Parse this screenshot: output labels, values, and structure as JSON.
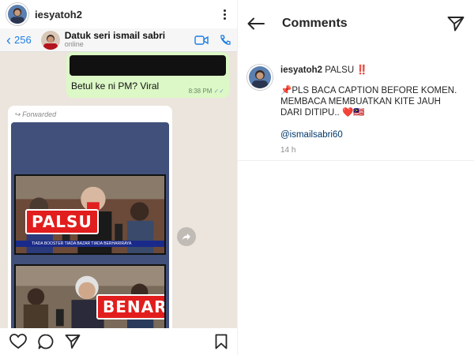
{
  "post": {
    "username": "iesyatoh2",
    "whatsapp": {
      "back_count": "256",
      "contact_name": "Datuk seri ismail sabri",
      "contact_status": "online",
      "outgoing_text": "Betul ke ni PM? Viral",
      "outgoing_time": "8:38 PM",
      "forwarded_label": "Forwarded",
      "stamp_fake": "PALSU",
      "stamp_real": "BENAR",
      "ticker_text": "TIADA BOOSTER TIADA BAZAR TIADA BERHARIRAYA"
    }
  },
  "comments": {
    "title": "Comments",
    "author": "iesyatoh2",
    "first_line": "PALSU ‼️",
    "body": "📌PLS BACA CAPTION BEFORE KOMEN. MEMBACA MEMBUATKAN KITE JAUH DARI DITIPU.. ❤️🇲🇾",
    "mention": "@ismailsabri60",
    "time": "14 h"
  },
  "colors": {
    "whatsapp_blue": "#1d7fe5",
    "bubble_green": "#dcf8c6",
    "stamp_red": "#e21d1d",
    "chat_bg": "#ece5dd"
  }
}
